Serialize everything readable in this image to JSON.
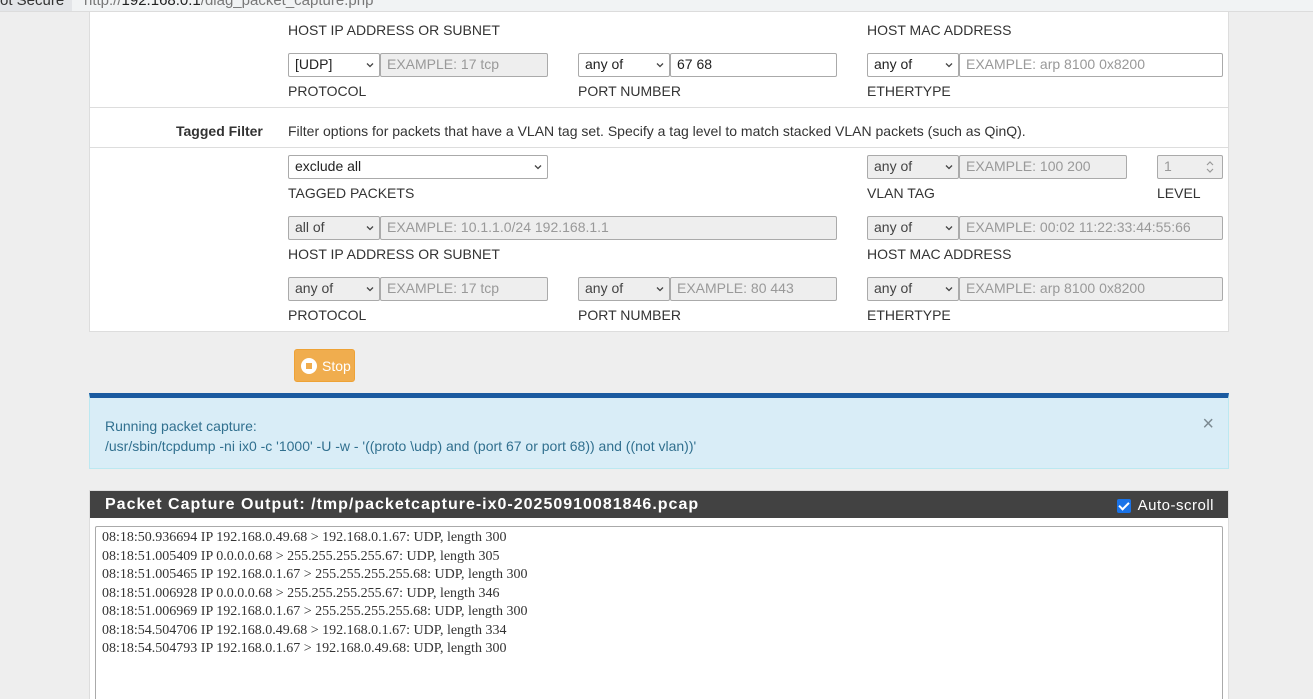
{
  "browser": {
    "security_label": "ot Secure",
    "url_prefix": "http://",
    "url_host": "192.168.0.1",
    "url_path": "/diag_packet_capture.php"
  },
  "untagged": {
    "host_ip_caption": "HOST IP ADDRESS OR SUBNET",
    "host_mac_caption": "HOST MAC ADDRESS",
    "protocol": {
      "select": "[UDP]",
      "placeholder": "EXAMPLE: 17 tcp",
      "caption": "PROTOCOL"
    },
    "port": {
      "select": "any of",
      "value": "67 68",
      "caption": "PORT NUMBER"
    },
    "ethertype": {
      "select": "any of",
      "placeholder": "EXAMPLE: arp 8100 0x8200",
      "caption": "ETHERTYPE"
    }
  },
  "tagged": {
    "label": "Tagged Filter",
    "description": "Filter options for packets that have a VLAN tag set. Specify a tag level to match stacked VLAN packets (such as QinQ).",
    "tagged_packets": {
      "select": "exclude all",
      "caption": "TAGGED PACKETS"
    },
    "vlan_tag": {
      "select": "any of",
      "placeholder": "EXAMPLE: 100 200",
      "caption": "VLAN TAG"
    },
    "level": {
      "value": "1",
      "caption": "LEVEL"
    },
    "host_ip": {
      "select": "all of",
      "placeholder": "EXAMPLE: 10.1.1.0/24 192.168.1.1",
      "caption": "HOST IP ADDRESS OR SUBNET"
    },
    "host_mac": {
      "select": "any of",
      "placeholder": "EXAMPLE: 00:02 11:22:33:44:55:66",
      "caption": "HOST MAC ADDRESS"
    },
    "protocol": {
      "select": "any of",
      "placeholder": "EXAMPLE: 17 tcp",
      "caption": "PROTOCOL"
    },
    "port": {
      "select": "any of",
      "placeholder": "EXAMPLE: 80 443",
      "caption": "PORT NUMBER"
    },
    "ethertype": {
      "select": "any of",
      "placeholder": "EXAMPLE: arp 8100 0x8200",
      "caption": "ETHERTYPE"
    }
  },
  "stop_button": "Stop",
  "alert": {
    "line1": "Running packet capture:",
    "line2": "/usr/sbin/tcpdump -ni ix0 -c '1000' -U -w - '((proto \\udp) and (port 67 or port 68)) and ((not vlan))'",
    "close": "×"
  },
  "output": {
    "title": "Packet Capture Output: /tmp/packetcapture-ix0-20250910081846.pcap",
    "autoscroll_label": "Auto-scroll",
    "lines": [
      "08:18:50.936694 IP 192.168.0.49.68 > 192.168.0.1.67: UDP, length 300",
      "08:18:51.005409 IP 0.0.0.0.68 > 255.255.255.255.67: UDP, length 305",
      "08:18:51.005465 IP 192.168.0.1.67 > 255.255.255.255.68: UDP, length 300",
      "08:18:51.006928 IP 0.0.0.0.68 > 255.255.255.255.67: UDP, length 346",
      "08:18:51.006969 IP 192.168.0.1.67 > 255.255.255.255.68: UDP, length 300",
      "08:18:54.504706 IP 192.168.0.49.68 > 192.168.0.1.67: UDP, length 334",
      "08:18:54.504793 IP 192.168.0.1.67 > 192.168.0.49.68: UDP, length 300"
    ]
  },
  "colors": {
    "accent": "#1a5aa0",
    "warning": "#f0ad4e",
    "alert_bg": "#d9edf7",
    "alert_text": "#31708f",
    "header_dark": "#424242"
  }
}
